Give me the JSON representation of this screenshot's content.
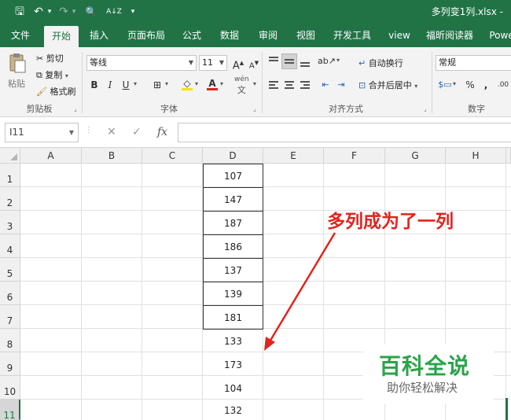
{
  "titlebar": {
    "filename": "多列变1列.xlsx -",
    "qat": {
      "save": "🖫",
      "undo": "↶",
      "undo_dd": "▾",
      "redo": "↷",
      "redo_dd": "▾",
      "preview": "🔍",
      "sort": "A↓Z",
      "customize": "▾"
    }
  },
  "tabs": [
    "文件",
    "开始",
    "插入",
    "页面布局",
    "公式",
    "数据",
    "审阅",
    "视图",
    "开发工具",
    "view",
    "福昕阅读器",
    "Powe"
  ],
  "active_tab": "开始",
  "ribbon": {
    "clipboard": {
      "paste": "粘贴",
      "cut": "剪切",
      "copy": "复制",
      "format_painter": "格式刷",
      "group_label": "剪贴板"
    },
    "font": {
      "font_name": "等线",
      "font_size": "11",
      "grow": "A",
      "shrink": "A",
      "bold": "B",
      "italic": "I",
      "underline": "U",
      "border": "⊞",
      "fill": "◇",
      "font_color": "A",
      "wen": "wén",
      "wen_char": "文",
      "group_label": "字体"
    },
    "alignment": {
      "wrap": "自动换行",
      "merge": "合并后居中",
      "group_label": "对齐方式"
    },
    "number": {
      "format": "常规",
      "percent": "%",
      "comma": ",",
      "decimals": ".00",
      "group_label": "数字"
    }
  },
  "formula_bar": {
    "name_box": "I11",
    "cancel": "✕",
    "enter": "✓",
    "fx": "fx",
    "formula": ""
  },
  "grid": {
    "columns": [
      "A",
      "B",
      "C",
      "D",
      "E",
      "F",
      "G",
      "H"
    ],
    "rows": [
      "1",
      "2",
      "3",
      "4",
      "5",
      "6",
      "7",
      "8",
      "9",
      "10",
      "11"
    ],
    "selected_row": "11",
    "column_d": [
      "107",
      "147",
      "187",
      "186",
      "137",
      "139",
      "181",
      "133",
      "173",
      "104",
      "132"
    ]
  },
  "annotation": {
    "text": "多列成为了一列",
    "color": "#e1241f"
  },
  "watermark": {
    "title": "百科全说",
    "subtitle": "助你轻松解决"
  },
  "colors": {
    "excel_green": "#217346",
    "watermark_green": "#2aa34a"
  }
}
